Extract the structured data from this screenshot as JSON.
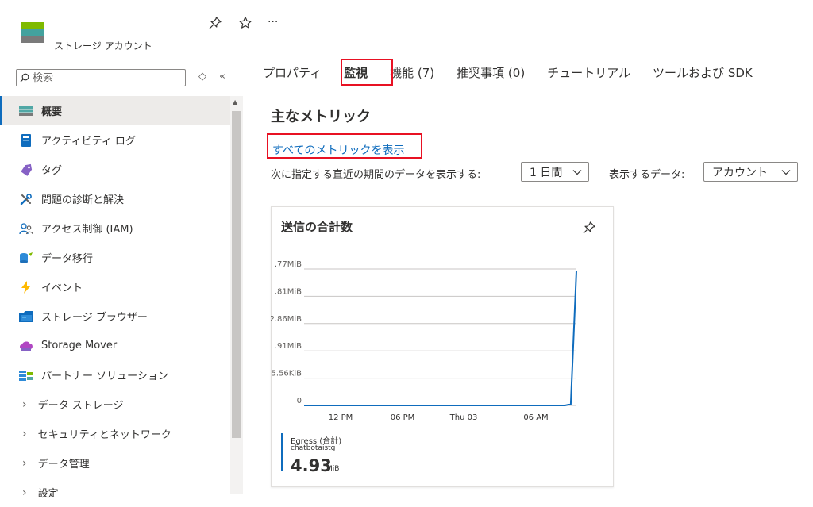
{
  "header": {
    "resource_type": "ストレージ アカウント",
    "more_label": "···"
  },
  "sidebar": {
    "search_placeholder": "検索",
    "items": [
      {
        "label": "概要",
        "icon": "overview-icon",
        "active": true
      },
      {
        "label": "アクティビティ ログ",
        "icon": "activity-log-icon"
      },
      {
        "label": "タグ",
        "icon": "tag-icon"
      },
      {
        "label": "問題の診断と解決",
        "icon": "wrench-icon"
      },
      {
        "label": "アクセス制御 (IAM)",
        "icon": "people-icon"
      },
      {
        "label": "データ移行",
        "icon": "data-migration-icon"
      },
      {
        "label": "イベント",
        "icon": "lightning-icon"
      },
      {
        "label": "ストレージ ブラウザー",
        "icon": "storage-browser-icon"
      },
      {
        "label": "Storage Mover",
        "icon": "storage-mover-icon"
      },
      {
        "label": "パートナー ソリューション",
        "icon": "partner-icon"
      },
      {
        "label": "データ ストレージ",
        "expandable": true
      },
      {
        "label": "セキュリティとネットワーク",
        "expandable": true
      },
      {
        "label": "データ管理",
        "expandable": true
      },
      {
        "label": "設定",
        "expandable": true
      }
    ]
  },
  "tabs": [
    {
      "label": "プロパティ"
    },
    {
      "label": "監視",
      "active": true
    },
    {
      "label": "機能 (7)"
    },
    {
      "label": "推奨事項 (0)"
    },
    {
      "label": "チュートリアル"
    },
    {
      "label": "ツールおよび SDK"
    }
  ],
  "main": {
    "section_title": "主なメトリック",
    "metrics_link": "すべてのメトリックを表示",
    "period_label": "次に指定する直近の期間のデータを表示する:",
    "period_value": "1 日間",
    "data_label": "表示するデータ:",
    "data_value": "アカウント"
  },
  "chart_card": {
    "title": "送信の合計数",
    "legend_name": "Egress (合計)",
    "legend_resource": "chatbotaistg",
    "legend_value": "4.93",
    "legend_unit": "MiB"
  },
  "colors": {
    "accent": "#0f6cbd",
    "highlight_border": "#e81123",
    "series": "#0f6cbd"
  },
  "chart_data": {
    "type": "line",
    "title": "送信の合計数",
    "ytick_labels": [
      "0",
      "5.56KiB",
      ".91MiB",
      "2.86MiB",
      ".81MiB",
      ".77MiB"
    ],
    "xtick_labels": [
      "12 PM",
      "06 PM",
      "Thu 03",
      "06 AM"
    ],
    "grid": true,
    "series": [
      {
        "name": "Egress (合計)",
        "x": [
          0,
          1,
          2,
          3,
          4,
          5,
          6,
          7,
          8,
          9,
          10,
          11,
          12,
          13,
          14,
          15,
          16,
          17,
          18,
          19,
          20,
          21,
          22,
          23,
          23.5,
          24
        ],
        "y": [
          0,
          0,
          0,
          0,
          0,
          0,
          0,
          0,
          0,
          0,
          0,
          0,
          0,
          0,
          0,
          0,
          0,
          0,
          0,
          0,
          0,
          0,
          0,
          0,
          0.05,
          4.93
        ]
      }
    ],
    "y_units": "MiB",
    "ylim": [
      0,
      5
    ],
    "xlim": [
      0,
      24
    ]
  }
}
